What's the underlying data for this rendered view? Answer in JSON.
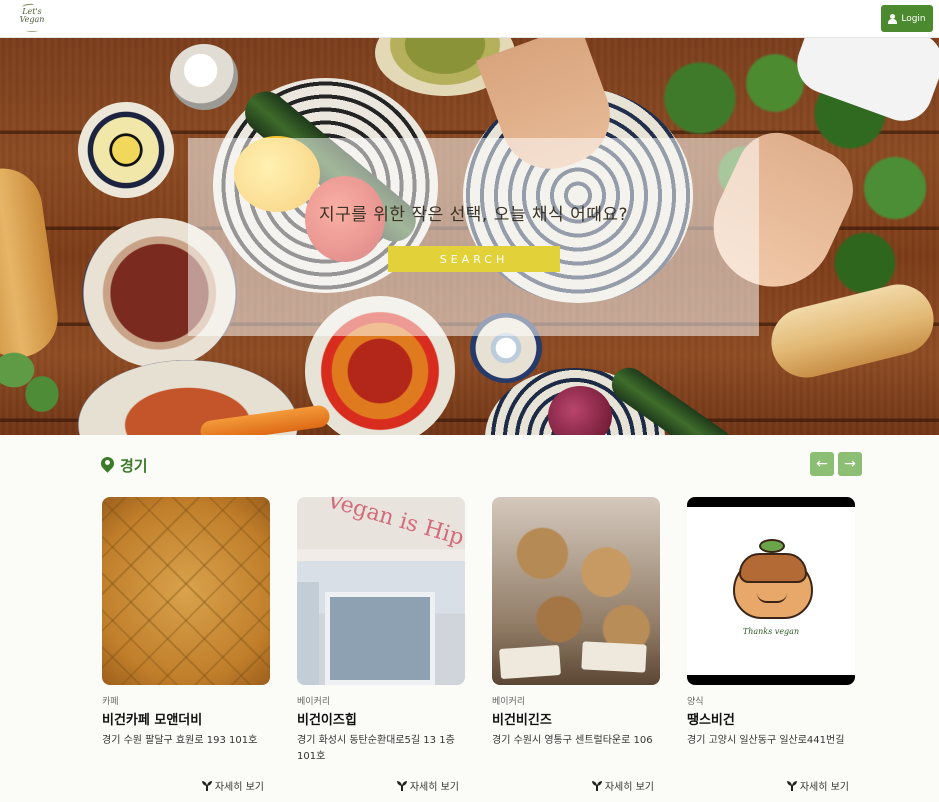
{
  "header": {
    "logo_line1": "Let's",
    "logo_line2": "Vegan",
    "login_label": "Login"
  },
  "hero": {
    "headline": "지구를 위한 작은 선택, 오늘 채식 어때요?",
    "search_label": "SEARCH"
  },
  "region": {
    "name": "경기",
    "prev_label": "←",
    "next_label": "→"
  },
  "cards": [
    {
      "category": "카페",
      "name": "비건카페 모앤더비",
      "address": "경기 수원 팔달구 효원로 193 101호",
      "detail_label": "자세히 보기"
    },
    {
      "category": "베이커리",
      "name": "비건이즈힙",
      "address": "경기 화성시 동탄순환대로5길 13 1층 101호",
      "detail_label": "자세히 보기",
      "sign_text": "Vegan is Hip"
    },
    {
      "category": "베이커리",
      "name": "비건비긴즈",
      "address": "경기 수원시 영통구 센트럴타운로 106",
      "detail_label": "자세히 보기"
    },
    {
      "category": "양식",
      "name": "땡스비건",
      "address": "경기 고양시 일산동구 일산로441번길",
      "detail_label": "자세히 보기",
      "logo_text": "Thanks vegan"
    }
  ],
  "colors": {
    "brand_green": "#4c8a2f",
    "region_green": "#3b7a28",
    "nav_green": "#8cbf74",
    "search_yellow": "#e3d13a"
  }
}
